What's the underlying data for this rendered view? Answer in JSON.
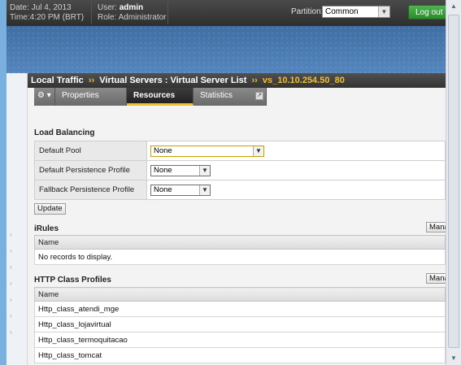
{
  "header": {
    "date_label": "Date:",
    "date_value": "Jul 4, 2013",
    "time_label": "Time:",
    "time_value": "4:20 PM (BRT)",
    "user_label": "User:",
    "user_value": "admin",
    "role_label": "Role:",
    "role_value": "Administrator",
    "partition_label": "Partition:",
    "partition_value": "Common",
    "logout_label": "Log out"
  },
  "breadcrumb": {
    "part1": "Local Traffic",
    "sep": "››",
    "part2": "Virtual Servers : Virtual Server List",
    "current": "vs_10.10.254.50_80"
  },
  "tabs": {
    "properties": "Properties",
    "resources": "Resources",
    "statistics": "Statistics"
  },
  "load_balancing": {
    "title": "Load Balancing",
    "rows": [
      {
        "label": "Default Pool",
        "value": "None"
      },
      {
        "label": "Default Persistence Profile",
        "value": "None"
      },
      {
        "label": "Fallback Persistence Profile",
        "value": "None"
      }
    ],
    "update_label": "Update"
  },
  "irules": {
    "title": "iRules",
    "manage_label": "Manage...",
    "column": "Name",
    "empty_text": "No records to display."
  },
  "http_class": {
    "title": "HTTP Class Profiles",
    "manage_label": "Manage...",
    "column": "Name",
    "rows": [
      "Http_class_atendi_mge",
      "Http_class_lojavirtual",
      "Http_class_termoquitacao",
      "Http_class_tomcat"
    ]
  },
  "colors": {
    "accent": "#f0c030",
    "topbar": "#333333",
    "banner": "#4a7bb0"
  }
}
